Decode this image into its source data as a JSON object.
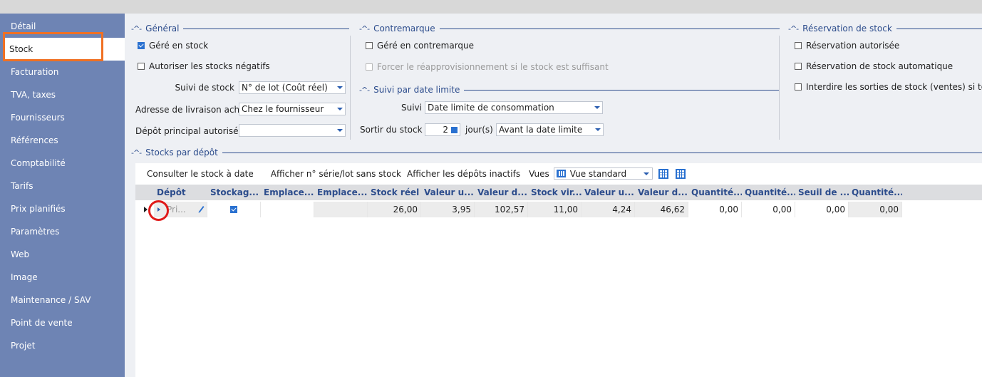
{
  "sidebar": {
    "items": [
      {
        "label": "Détail"
      },
      {
        "label": "Stock"
      },
      {
        "label": "Facturation"
      },
      {
        "label": "TVA, taxes"
      },
      {
        "label": "Fournisseurs"
      },
      {
        "label": "Références"
      },
      {
        "label": "Comptabilité"
      },
      {
        "label": "Tarifs"
      },
      {
        "label": "Prix planifiés"
      },
      {
        "label": "Paramètres"
      },
      {
        "label": "Web"
      },
      {
        "label": "Image"
      },
      {
        "label": "Maintenance / SAV"
      },
      {
        "label": "Point de vente"
      },
      {
        "label": "Projet"
      }
    ],
    "active": "Stock"
  },
  "general": {
    "title": "Général",
    "gere_en_stock": {
      "label": "Géré en stock",
      "checked": true
    },
    "autoriser_negatifs": {
      "label": "Autoriser les stocks négatifs",
      "checked": false
    },
    "suivi_stock": {
      "label": "Suivi de stock",
      "value": "N° de lot (Coût réel)"
    },
    "adresse_livraison": {
      "label": "Adresse de livraison achat",
      "value": "Chez le fournisseur"
    },
    "depot_principal": {
      "label": "Dépôt principal autorisé",
      "value": ""
    }
  },
  "contremarque": {
    "title": "Contremarque",
    "gere_contremarque": {
      "label": "Géré en contremarque",
      "checked": false
    },
    "forcer_reappro": {
      "label": "Forcer le réapprovisionnement si le stock est suffisant",
      "checked": false
    }
  },
  "suivi_date": {
    "title": "Suivi par date limite",
    "suivi": {
      "label": "Suivi",
      "value": "Date limite de consommation"
    },
    "sortir": {
      "label": "Sortir du stock",
      "value": "2",
      "unit": "jour(s)",
      "mode": "Avant la date limite"
    }
  },
  "reservation": {
    "title": "Réservation de stock",
    "autorisee": {
      "label": "Réservation autorisée",
      "checked": false
    },
    "automatique": {
      "label": "Réservation de stock automatique",
      "checked": false
    },
    "interdire": {
      "label": "Interdire les sorties de stock (ventes) si totale",
      "checked": false
    }
  },
  "stocks_depot": {
    "title": "Stocks par dépôt",
    "toolbar": {
      "consulter": "Consulter le stock à date",
      "afficher_serie": "Afficher n° série/lot sans stock",
      "afficher_inactifs": "Afficher les dépôts inactifs",
      "vues_label": "Vues",
      "vues_value": "Vue standard"
    },
    "columns": [
      "Dépôt",
      "Stockag...",
      "Emplace...",
      "Emplace...",
      "Stock réel",
      "Valeur u...",
      "Valeur d...",
      "Stock vir...",
      "Valeur u...",
      "Valeur d...",
      "Quantité...",
      "Quantité...",
      "Seuil de ...",
      "Quantité..."
    ],
    "rows": [
      {
        "depot": "Pri...",
        "stockage": true,
        "emp1": "",
        "emp2": "",
        "stock_reel": "26,00",
        "val_u1": "3,95",
        "val_d1": "102,57",
        "stock_vir": "11,00",
        "val_u2": "4,24",
        "val_d2": "46,62",
        "q1": "0,00",
        "q2": "0,00",
        "seuil": "0,00",
        "q3": "0,00"
      }
    ]
  }
}
